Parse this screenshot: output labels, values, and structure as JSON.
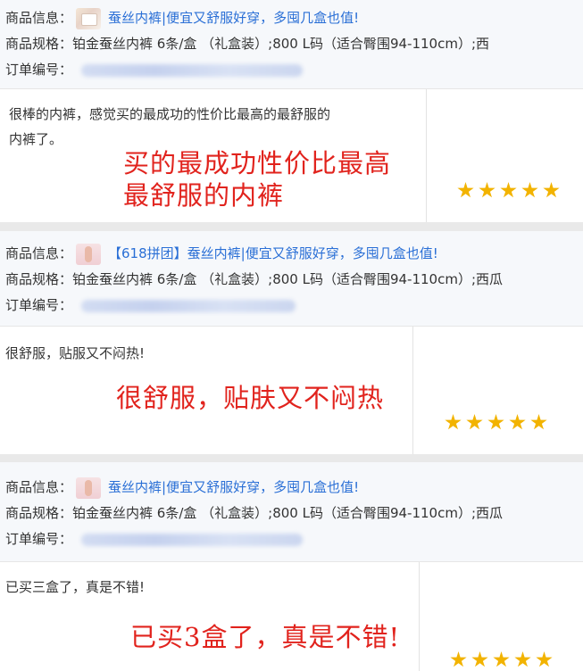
{
  "labels": {
    "product_info": "商品信息：",
    "product_spec": "商品规格：",
    "order_no": "订单编号："
  },
  "reviews": [
    {
      "thumbnail_icon": "gift-box-image",
      "product_title": "蚕丝内裤|便宜又舒服好穿，多囤几盒也值!",
      "spec": "铂金蚕丝内裤 6条/盒 （礼盒装）;800 L码（适合臀围94-110cm）;西",
      "review_lines": [
        "很棒的内裤，感觉买的最成功的性价比最高的最舒服的",
        "内裤了。"
      ],
      "annotation_lines": [
        "买的最成功性价比最高",
        "最舒服的内裤"
      ],
      "rating": 5
    },
    {
      "thumbnail_icon": "model-photo",
      "product_title": "【618拼团】蚕丝内裤|便宜又舒服好穿，多囤几盒也值!",
      "spec": "铂金蚕丝内裤 6条/盒 （礼盒装）;800 L码（适合臀围94-110cm）;西瓜",
      "review_lines": [
        "很舒服，贴服又不闷热!"
      ],
      "annotation_lines": [
        "很舒服，贴肤又不闷热"
      ],
      "rating": 5
    },
    {
      "thumbnail_icon": "model-photo",
      "product_title": "蚕丝内裤|便宜又舒服好穿，多囤几盒也值!",
      "spec": "铂金蚕丝内裤 6条/盒 （礼盒装）;800 L码（适合臀围94-110cm）;西瓜",
      "review_lines": [
        "已买三盒了，真是不错!"
      ],
      "annotation_lines": [
        "已买3盒了，真是不错!"
      ],
      "rating": 5
    }
  ],
  "colors": {
    "link": "#2a6fd6",
    "annotation": "#e1231d",
    "star": "#f2b300"
  }
}
